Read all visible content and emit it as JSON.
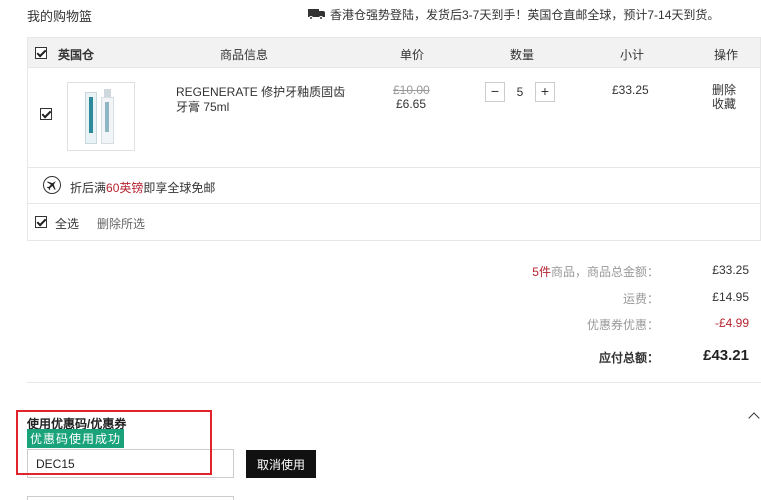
{
  "page": {
    "title": "我的购物篮",
    "shipping_note": "香港仓强势登陆，发货后3-7天到手！英国仓直邮全球，预计7-14天到货。"
  },
  "cart": {
    "headers": {
      "warehouse": "英国仓",
      "product_info": "商品信息",
      "unit_price": "单价",
      "quantity": "数量",
      "subtotal": "小计",
      "actions": "操作"
    },
    "item": {
      "name": "REGENERATE 修护牙釉质固齿牙膏 75ml",
      "old_price": "£10.00",
      "price": "£6.65",
      "quantity": "5",
      "decrement": "−",
      "increment": "+",
      "subtotal": "£33.25",
      "delete_label": "删除",
      "favorite_label": "收藏",
      "checked": true
    },
    "promo": {
      "prefix": "折后满",
      "highlight": "60英镑",
      "suffix": "即享全球免邮"
    },
    "select_all_label": "全选",
    "delete_selected_label": "删除所选"
  },
  "summary": {
    "count_highlight": "5件",
    "goods_label": "商品，商品总金额：",
    "goods_value": "£33.25",
    "shipping_label": "运费：",
    "shipping_value": "£14.95",
    "coupon_label": "优惠券优惠：",
    "coupon_value": "-£4.99",
    "total_label": "应付总额：",
    "total_value": "£43.21"
  },
  "coupon": {
    "title": "使用优惠码/优惠券",
    "success_text": "优惠码使用成功",
    "code_value": "DEC15",
    "cancel_label": "取消使用"
  },
  "colors": {
    "accent_red": "#b5232f",
    "success_green": "#1aa37a",
    "button_black": "#111111",
    "highlight_box": "#e0242c"
  }
}
